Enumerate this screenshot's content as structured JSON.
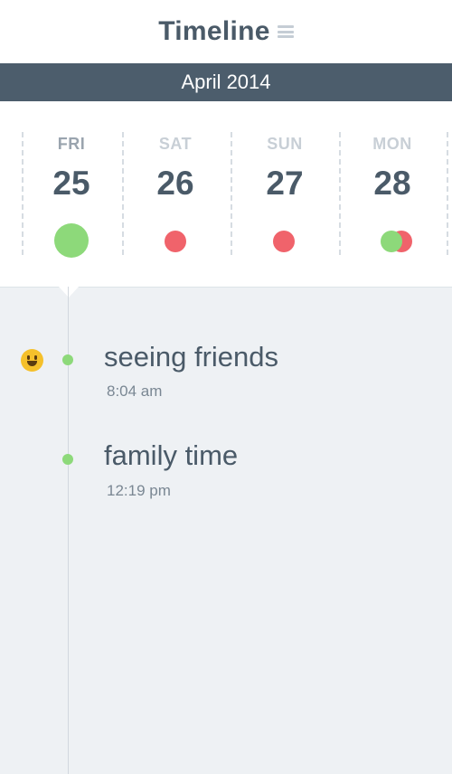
{
  "header": {
    "title": "Timeline",
    "menu_icon": "hamburger-menu-icon"
  },
  "month": {
    "label": "April 2014"
  },
  "days": [
    {
      "name": "FRI",
      "num": "25",
      "name_color": "#9aa4ae",
      "moods": [
        "good"
      ]
    },
    {
      "name": "SAT",
      "num": "26",
      "name_color": "#c8cfd6",
      "moods": [
        "bad"
      ]
    },
    {
      "name": "SUN",
      "num": "27",
      "name_color": "#c8cfd6",
      "moods": [
        "bad"
      ]
    },
    {
      "name": "MON",
      "num": "28",
      "name_color": "#c8cfd6",
      "moods": [
        "good",
        "bad"
      ]
    }
  ],
  "entries": [
    {
      "title": "seeing friends",
      "time": "8:04 am",
      "icon": "happy-emoji-icon"
    },
    {
      "title": "family time",
      "time": "12:19 pm"
    }
  ],
  "colors": {
    "good": "#8dd97a",
    "bad": "#f0636b",
    "header_bar": "#4c5d6c",
    "text": "#4a5a68"
  }
}
